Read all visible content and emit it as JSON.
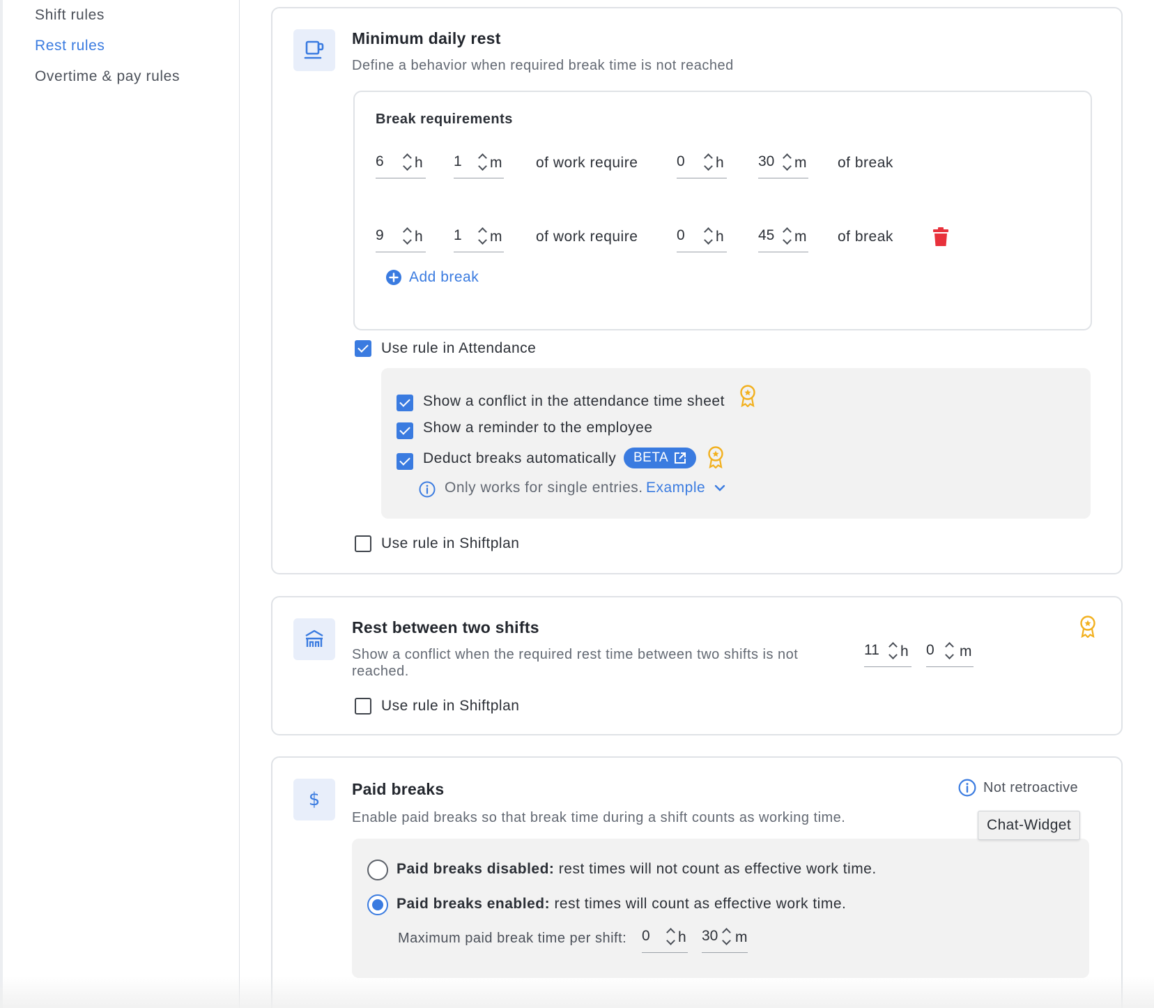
{
  "sidebar": {
    "items": [
      {
        "label": "Shift rules"
      },
      {
        "label": "Rest rules"
      },
      {
        "label": "Overtime & pay rules"
      }
    ]
  },
  "daily_rest": {
    "title": "Minimum daily rest",
    "description": "Define a behavior when required break time is not reached",
    "break_requirements_title": "Break requirements",
    "rows": [
      {
        "work_h": "6",
        "work_m": "1",
        "mid_text": "of work require",
        "break_h": "0",
        "break_m": "30",
        "end_text": "of break"
      },
      {
        "work_h": "9",
        "work_m": "1",
        "mid_text": "of work require",
        "break_h": "0",
        "break_m": "45",
        "end_text": "of break"
      }
    ],
    "unit_h": "h",
    "unit_m": "m",
    "add_break_label": "Add break",
    "use_in_attendance": {
      "label": "Use rule in Attendance",
      "checked": true
    },
    "attendance_options": [
      {
        "label": "Show a conflict in the attendance time sheet",
        "checked": true
      },
      {
        "label": "Show a reminder to the employee",
        "checked": true
      },
      {
        "label": "Deduct breaks automatically",
        "checked": true
      }
    ],
    "beta_label": "BETA",
    "info_text": "Only works for single entries.",
    "example_label": "Example",
    "use_in_shiftplan": {
      "label": "Use rule in Shiftplan",
      "checked": false
    }
  },
  "rest_between": {
    "title": "Rest between two shifts",
    "description": "Show a conflict when the required rest time between two shifts is not reached.",
    "hours": "11",
    "minutes": "0",
    "use_in_shiftplan": {
      "label": "Use rule in Shiftplan",
      "checked": false
    }
  },
  "paid_breaks": {
    "title": "Paid breaks",
    "description": "Enable paid breaks so that break time during a shift counts as working time.",
    "not_retroactive": "Not retroactive",
    "tooltip": "Chat-Widget",
    "options": [
      {
        "bold": "Paid breaks disabled:",
        "text": "rest times will not count as effective work time.",
        "selected": false
      },
      {
        "bold": "Paid breaks enabled:",
        "text": "rest times will count as effective work time.",
        "selected": true
      }
    ],
    "max_label": "Maximum paid break time per shift:",
    "max_h": "0",
    "max_m": "30"
  },
  "colors": {
    "accent": "#3a7be0",
    "danger": "#e8313b",
    "premium": "#f2b01e",
    "icon_bg": "#e8eefa"
  }
}
